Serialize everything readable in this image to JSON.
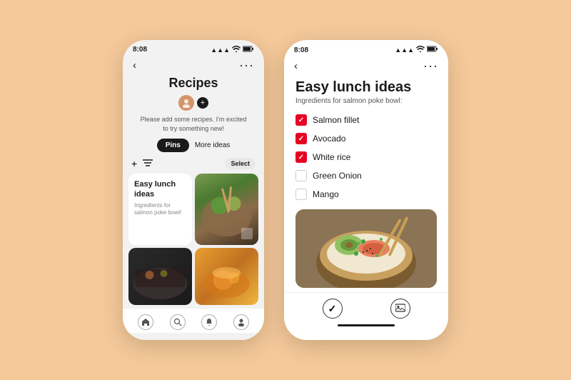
{
  "background_color": "#f5c99a",
  "left_phone": {
    "status": {
      "time": "8:08",
      "signal": "▲▲▲",
      "wifi": "wifi",
      "battery": "🔋"
    },
    "nav": {
      "back_icon": "‹",
      "more_icon": "···"
    },
    "title": "Recipes",
    "avatar_placeholder": "👤",
    "add_label": "+",
    "placeholder_text": "Please add some recipes. I'm excited to try something new!",
    "tabs": [
      {
        "label": "Pins",
        "active": true
      },
      {
        "label": "More ideas",
        "active": false
      }
    ],
    "toolbar": {
      "add_icon": "+",
      "filter_icon": "⊟",
      "select_label": "Select"
    },
    "pins": [
      {
        "id": "pin1",
        "title": "Easy lunch ideas",
        "subtitle": "Ingredients for salmon poke bowl!",
        "type": "text-card"
      },
      {
        "id": "pin2",
        "type": "image",
        "img_desc": "poke bowl dark"
      },
      {
        "id": "pin3",
        "type": "image",
        "img_desc": "dark food pan"
      },
      {
        "id": "pin4",
        "type": "image",
        "img_desc": "soup bowl orange"
      }
    ],
    "bottom_nav": [
      {
        "icon": "⊙",
        "name": "home"
      },
      {
        "icon": "⊗",
        "name": "search"
      },
      {
        "icon": "🔔",
        "name": "notifications"
      },
      {
        "icon": "👤",
        "name": "profile"
      }
    ]
  },
  "right_phone": {
    "status": {
      "time": "8:08",
      "signal": "▲▲▲",
      "wifi": "wifi",
      "battery": "🔋"
    },
    "nav": {
      "back_icon": "‹",
      "more_icon": "···"
    },
    "title": "Easy lunch ideas",
    "subtitle": "Ingredients for salmon poke bowl:",
    "ingredients": [
      {
        "name": "Salmon fillet",
        "checked": true
      },
      {
        "name": "Avocado",
        "checked": true
      },
      {
        "name": "White rice",
        "checked": true
      },
      {
        "name": "Green Onion",
        "checked": false
      },
      {
        "name": "Mango",
        "checked": false
      }
    ],
    "bottom_nav": [
      {
        "icon": "✓",
        "name": "check"
      },
      {
        "icon": "🖼",
        "name": "image"
      }
    ]
  }
}
